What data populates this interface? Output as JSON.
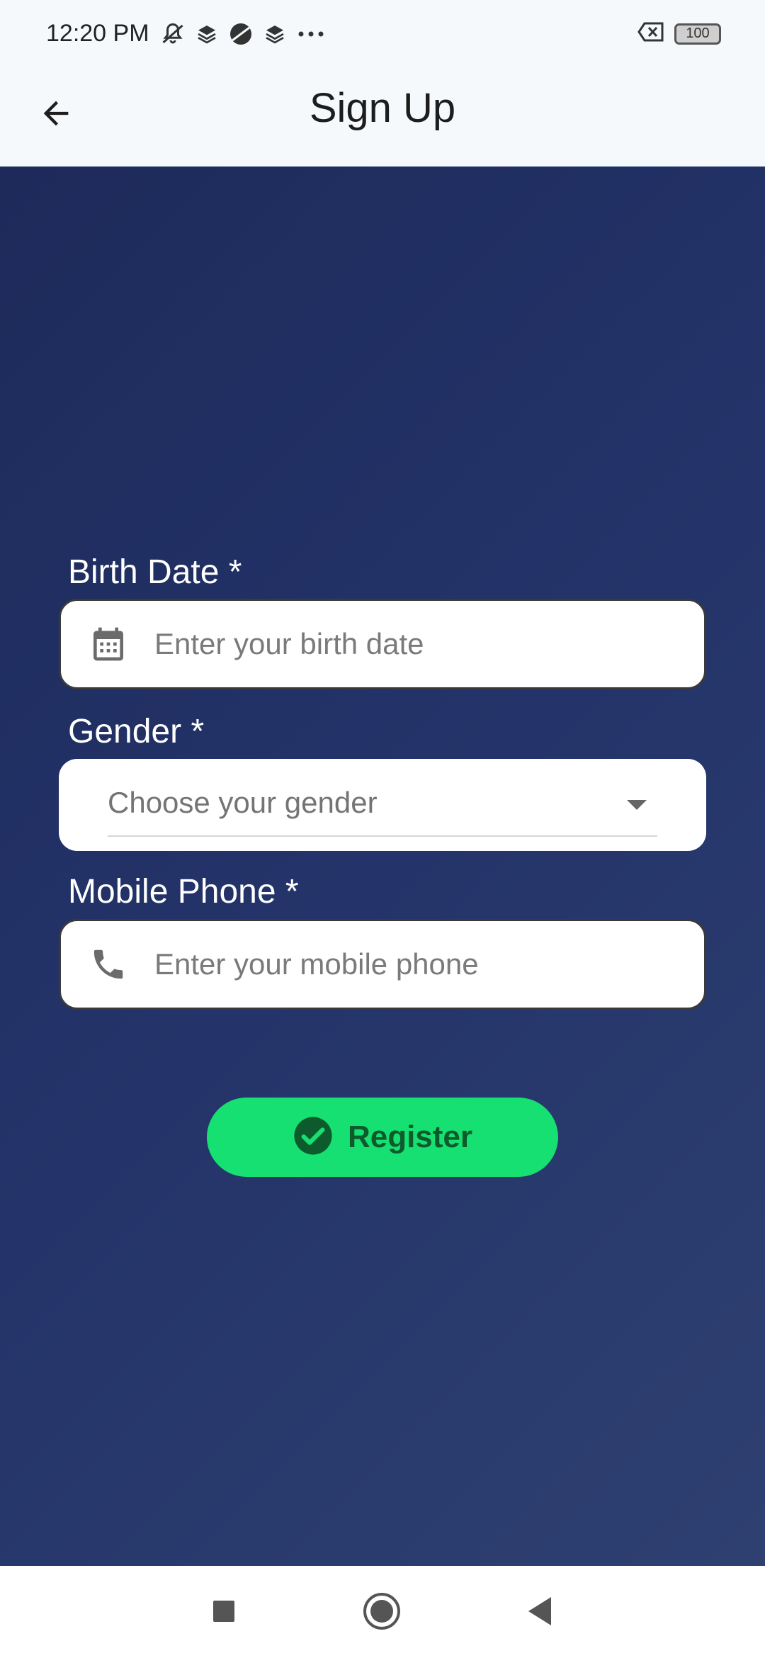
{
  "status_bar": {
    "time": "12:20 PM",
    "icons": [
      "muted-bell-icon",
      "stack-icon",
      "planet-icon",
      "stack-icon",
      "more-dots-icon"
    ],
    "right_icons": [
      "close-box-icon"
    ],
    "battery": "100"
  },
  "app_bar": {
    "title": "Sign Up",
    "back_icon": "arrow-left-icon"
  },
  "form": {
    "birth_date": {
      "label": "Birth Date *",
      "placeholder": "Enter your birth date",
      "icon": "calendar-icon"
    },
    "gender": {
      "label": "Gender *",
      "value": "Choose your gender"
    },
    "mobile_phone": {
      "label": "Mobile Phone *",
      "placeholder": "Enter your mobile phone",
      "icon": "phone-icon"
    },
    "register_label": "Register"
  },
  "colors": {
    "background_start": "#1d2a5a",
    "background_end": "#2e4070",
    "register_button": "#16e071",
    "register_text": "#0d5a2c"
  },
  "nav_bar": {
    "items": [
      "recents-square-icon",
      "home-circle-icon",
      "back-triangle-icon"
    ]
  }
}
